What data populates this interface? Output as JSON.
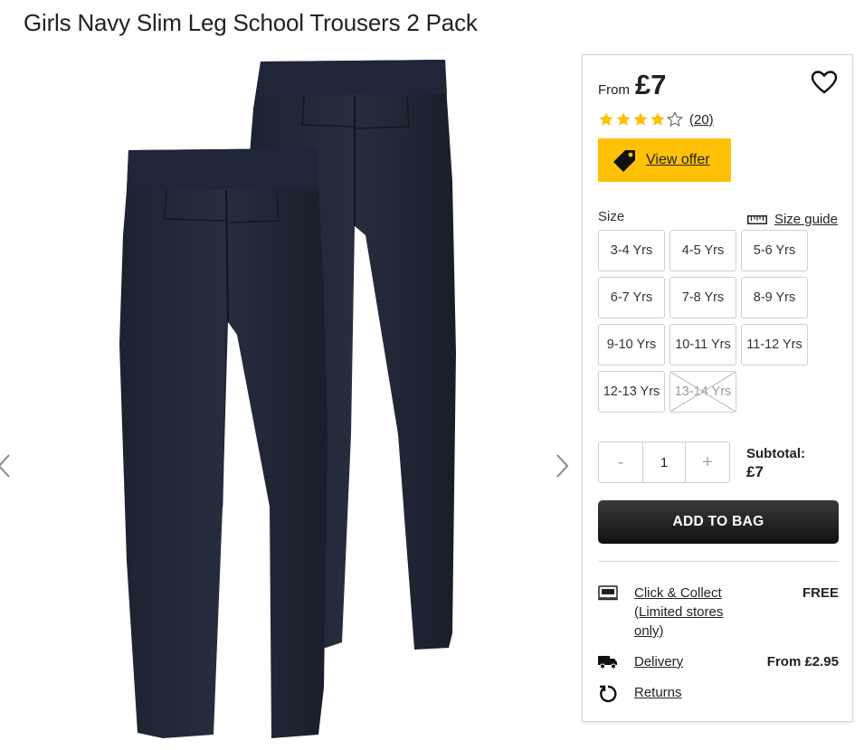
{
  "product": {
    "title": "Girls Navy Slim Leg School Trousers 2 Pack"
  },
  "gallery": {
    "prev_icon": "chevron-left-icon",
    "next_icon": "chevron-right-icon"
  },
  "pricing": {
    "from_label": "From",
    "price": "£7"
  },
  "rating": {
    "stars": 4.5,
    "max_stars": 5,
    "review_count": "(20)",
    "star_color": "#ffc107"
  },
  "offer": {
    "label": "View offer",
    "icon": "price-tag-icon",
    "color": "#ffc107"
  },
  "size": {
    "label": "Size",
    "guide_label": "Size guide",
    "options": [
      {
        "label": "3-4 Yrs",
        "available": true
      },
      {
        "label": "4-5 Yrs",
        "available": true
      },
      {
        "label": "5-6 Yrs",
        "available": true
      },
      {
        "label": "6-7 Yrs",
        "available": true
      },
      {
        "label": "7-8 Yrs",
        "available": true
      },
      {
        "label": "8-9 Yrs",
        "available": true
      },
      {
        "label": "9-10 Yrs",
        "available": true
      },
      {
        "label": "10-11 Yrs",
        "available": true
      },
      {
        "label": "11-12 Yrs",
        "available": true
      },
      {
        "label": "12-13 Yrs",
        "available": true
      },
      {
        "label": "13-14 Yrs",
        "available": false
      }
    ]
  },
  "quantity": {
    "minus": "-",
    "value": "1",
    "plus": "+"
  },
  "subtotal": {
    "label": "Subtotal:",
    "value": "£7"
  },
  "add_to_bag": {
    "label": "ADD TO BAG"
  },
  "delivery": {
    "click_collect_label": "Click & Collect (Limited stores only)",
    "click_collect_value": "FREE",
    "delivery_label": "Delivery",
    "delivery_value": "From £2.95",
    "returns_label": "Returns"
  }
}
